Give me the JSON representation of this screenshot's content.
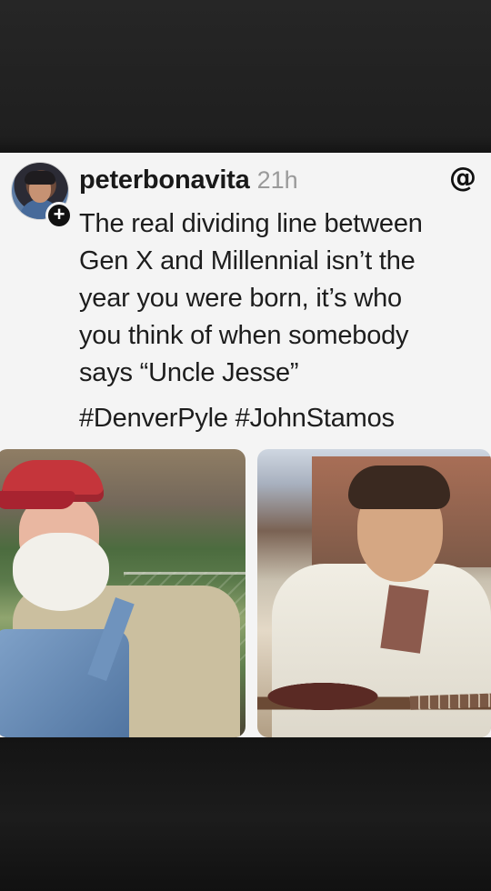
{
  "post": {
    "username": "peterbonavita",
    "time": "21h",
    "text": "The real dividing line between\nGen X and Millennial isn’t the\nyear you were born, it’s who\nyou think of when somebody\nsays “Uncle Jesse”",
    "hashtags": "#DenverPyle #JohnStamos",
    "icons": {
      "platform": "threads-icon",
      "follow": "plus-icon"
    }
  },
  "images": [
    {
      "subject": "older man with white beard in red cap"
    },
    {
      "subject": "smiling young man in white jacket holding guitar"
    }
  ],
  "colors": {
    "card_background": "#f4f4f4",
    "text": "#1d1d1d",
    "muted": "#9a9a9a",
    "background": "#141414"
  }
}
